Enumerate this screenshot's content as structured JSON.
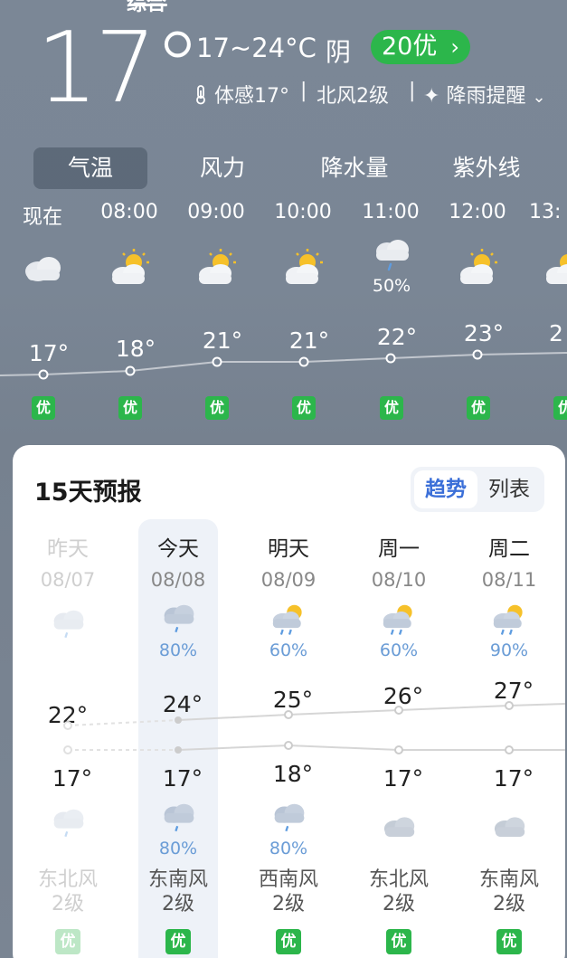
{
  "top_nav": {
    "items": [
      "",
      "综合",
      "",
      "",
      "",
      ""
    ]
  },
  "current": {
    "temp": "17°",
    "range": "17~24°C",
    "condition": "阴",
    "aqi": "20优",
    "feels_like": "体感17°",
    "wind": "北风2级",
    "rain_alert": "降雨提醒"
  },
  "tabs": [
    "气温",
    "风力",
    "降水量",
    "紫外线"
  ],
  "hourly": [
    {
      "time": "现在",
      "icon": "cloudy-icon",
      "pop": "",
      "temp": "17°",
      "aqi": "优"
    },
    {
      "time": "08:00",
      "icon": "partly-sunny-icon",
      "pop": "",
      "temp": "18°",
      "aqi": "优"
    },
    {
      "time": "09:00",
      "icon": "partly-sunny-icon",
      "pop": "",
      "temp": "21°",
      "aqi": "优"
    },
    {
      "time": "10:00",
      "icon": "partly-sunny-icon",
      "pop": "",
      "temp": "21°",
      "aqi": "优"
    },
    {
      "time": "11:00",
      "icon": "rain-cloud-icon",
      "pop": "50%",
      "temp": "22°",
      "aqi": "优"
    },
    {
      "time": "12:00",
      "icon": "partly-sunny-icon",
      "pop": "",
      "temp": "23°",
      "aqi": "优"
    },
    {
      "time": "13:",
      "icon": "partly-sunny-icon",
      "pop": "",
      "temp": "2",
      "aqi": "优"
    }
  ],
  "forecast": {
    "title": "15天预报",
    "toggle": {
      "trend": "趋势",
      "list": "列表"
    },
    "days": [
      {
        "name": "昨天",
        "date": "08/07",
        "day_icon": "rain-cloud-icon",
        "day_pop": "",
        "high": "22°",
        "low": "17°",
        "night_icon": "rain-cloud-icon",
        "night_pop": "",
        "wind_dir": "东北风",
        "wind_level": "2级",
        "aqi": "优"
      },
      {
        "name": "今天",
        "date": "08/08",
        "day_icon": "rain-cloud-icon",
        "day_pop": "80%",
        "high": "24°",
        "low": "17°",
        "night_icon": "rain-cloud-icon",
        "night_pop": "80%",
        "wind_dir": "东南风",
        "wind_level": "2级",
        "aqi": "优"
      },
      {
        "name": "明天",
        "date": "08/09",
        "day_icon": "sun-rain-icon",
        "day_pop": "60%",
        "high": "25°",
        "low": "18°",
        "night_icon": "rain-cloud-icon",
        "night_pop": "80%",
        "wind_dir": "西南风",
        "wind_level": "2级",
        "aqi": "优"
      },
      {
        "name": "周一",
        "date": "08/10",
        "day_icon": "sun-rain-icon",
        "day_pop": "60%",
        "high": "26°",
        "low": "17°",
        "night_icon": "cloudy-icon",
        "night_pop": "",
        "wind_dir": "东北风",
        "wind_level": "2级",
        "aqi": "优"
      },
      {
        "name": "周二",
        "date": "08/11",
        "day_icon": "sun-rain-icon",
        "day_pop": "90%",
        "high": "27°",
        "low": "17°",
        "night_icon": "cloudy-icon",
        "night_pop": "",
        "wind_dir": "东南风",
        "wind_level": "2级",
        "aqi": "优"
      }
    ]
  },
  "colors": {
    "aqi_good": "#2cb64b",
    "accent_blue": "#3b6fd8",
    "pop_blue": "#6a9cd6"
  }
}
